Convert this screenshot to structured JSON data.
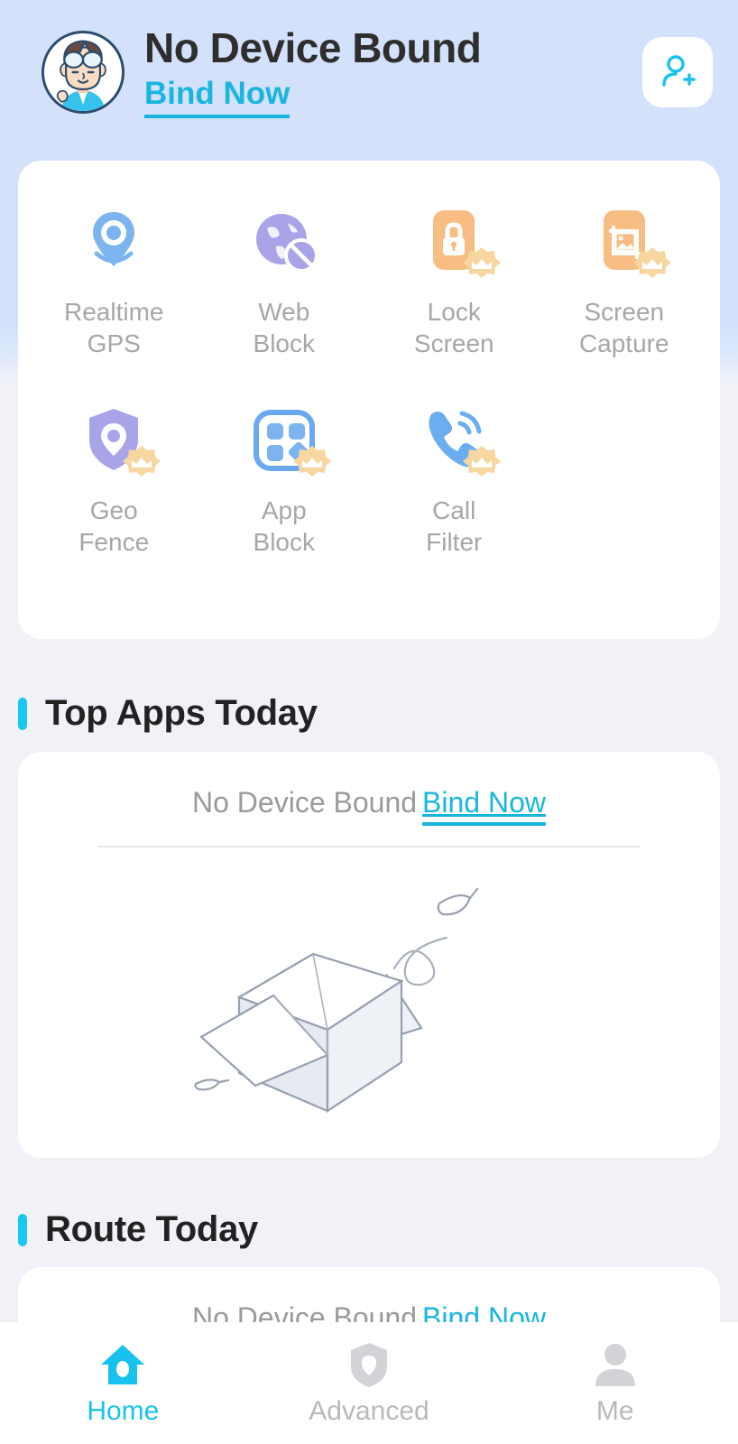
{
  "header": {
    "title": "No Device Bound",
    "bind_link": "Bind Now",
    "avatar_icon": "boy-avatar-icon",
    "add_button_icon": "add-user-icon"
  },
  "features": {
    "row1": [
      {
        "label": "Realtime\nGPS",
        "icon": "location-pin-icon",
        "premium": false,
        "color": "#7cb4f0"
      },
      {
        "label": "Web\nBlock",
        "icon": "globe-blocked-icon",
        "premium": false,
        "color": "#a9a4e8"
      },
      {
        "label": "Lock\nScreen",
        "icon": "lock-screen-icon",
        "premium": true,
        "color": "#f8bd83"
      },
      {
        "label": "Screen\nCapture",
        "icon": "screen-capture-icon",
        "premium": true,
        "color": "#f8bd83"
      }
    ],
    "row2": [
      {
        "label": "Geo\nFence",
        "icon": "shield-pin-icon",
        "premium": true,
        "color": "#a9a4e8"
      },
      {
        "label": "App\nBlock",
        "icon": "app-grid-icon",
        "premium": true,
        "color": "#6aa9f2"
      },
      {
        "label": "Call\nFilter",
        "icon": "phone-call-icon",
        "premium": true,
        "color": "#6aaef0"
      }
    ]
  },
  "sections": [
    {
      "title": "Top Apps Today",
      "notice_text": "No Device Bound",
      "notice_link": "Bind Now",
      "empty_art": "empty-box-illustration"
    },
    {
      "title": "Route Today",
      "notice_text": "No Device Bound",
      "notice_link": "Bind Now"
    }
  ],
  "bottom_nav": [
    {
      "label": "Home",
      "icon": "home-icon",
      "active": true
    },
    {
      "label": "Advanced",
      "icon": "shield-icon",
      "active": false
    },
    {
      "label": "Me",
      "icon": "person-icon",
      "active": false
    }
  ],
  "colors": {
    "accent_cyan": "#18c2ef",
    "link_cyan": "#18b5e0",
    "header_bg": "#d3e2fa",
    "page_bg": "#f1f2f7",
    "card_bg": "#ffffff",
    "muted_text": "#a7a7ab",
    "title_text": "#222222",
    "premium_gold": "#f6d59a"
  }
}
